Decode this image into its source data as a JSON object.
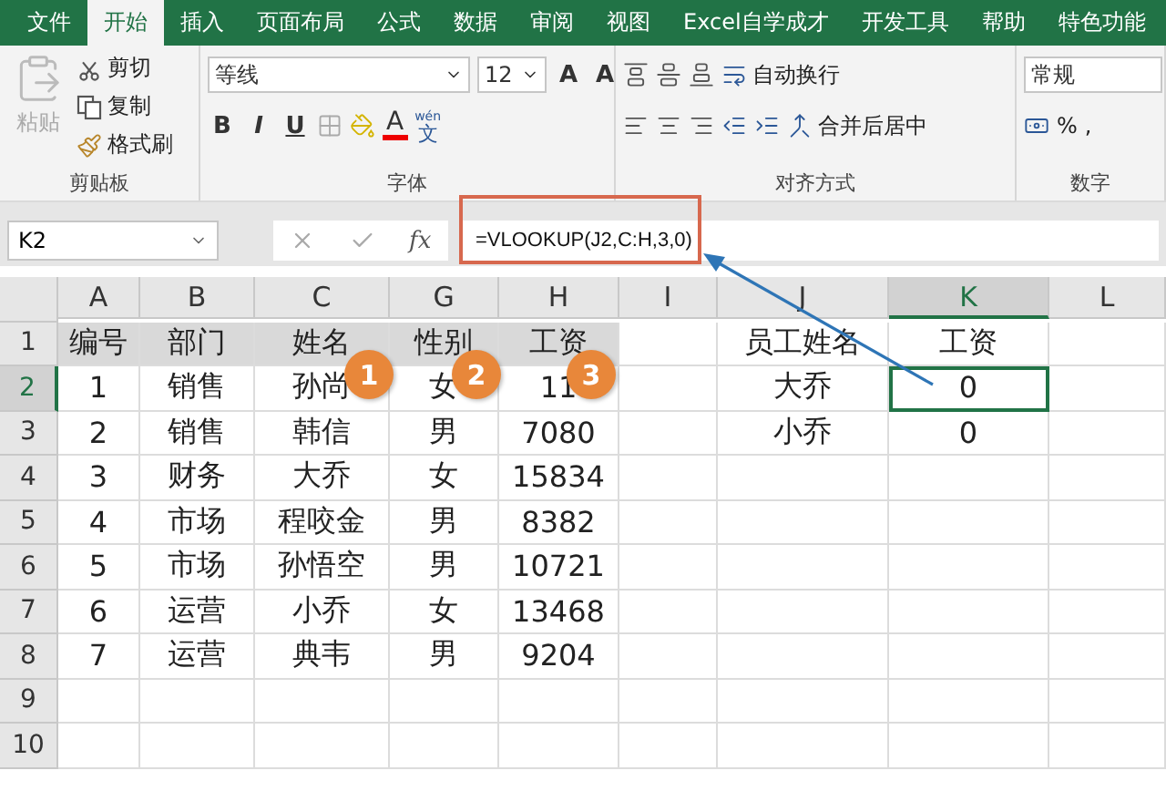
{
  "ribbon_tabs": [
    {
      "label": "文件",
      "selected": false
    },
    {
      "label": "开始",
      "selected": true
    },
    {
      "label": "插入",
      "selected": false
    },
    {
      "label": "页面布局",
      "selected": false
    },
    {
      "label": "公式",
      "selected": false
    },
    {
      "label": "数据",
      "selected": false
    },
    {
      "label": "审阅",
      "selected": false
    },
    {
      "label": "视图",
      "selected": false
    },
    {
      "label": "Excel自学成才",
      "selected": false
    },
    {
      "label": "开发工具",
      "selected": false
    },
    {
      "label": "帮助",
      "selected": false
    },
    {
      "label": "特色功能",
      "selected": false
    }
  ],
  "clipboard": {
    "paste": "粘贴",
    "cut": "剪切",
    "copy": "复制",
    "format_painter": "格式刷",
    "group_label": "剪贴板"
  },
  "font": {
    "name": "等线",
    "size": "12",
    "grow": "A",
    "shrink": "A",
    "bold": "B",
    "italic": "I",
    "underline": "U",
    "color_letter": "A",
    "phonetic_top": "wén",
    "phonetic_main": "文",
    "group_label": "字体"
  },
  "alignment": {
    "wrap": "自动换行",
    "merge": "合并后居中",
    "group_label": "对齐方式"
  },
  "number": {
    "format": "常规",
    "percent": "%",
    "comma": ",",
    "group_label": "数字"
  },
  "formula_bar": {
    "name_box": "K2",
    "fx": "fx",
    "formula": "=VLOOKUP(J2,C:H,3,0)"
  },
  "columns": [
    {
      "label": "A",
      "selected": false
    },
    {
      "label": "B",
      "selected": false
    },
    {
      "label": "C",
      "selected": false
    },
    {
      "label": "G",
      "selected": false
    },
    {
      "label": "H",
      "selected": false
    },
    {
      "label": "I",
      "selected": false
    },
    {
      "label": "J",
      "selected": false
    },
    {
      "label": "K",
      "selected": true
    },
    {
      "label": "L",
      "selected": false
    }
  ],
  "rows": [
    {
      "number": "1",
      "selected": false,
      "shaded": true,
      "cells": [
        "编号",
        "部门",
        "姓名",
        "性别",
        "工资",
        "",
        "员工姓名",
        "工资",
        ""
      ]
    },
    {
      "number": "2",
      "selected": true,
      "shaded": false,
      "cells": [
        "1",
        "销售",
        "孙尚",
        "女",
        "11",
        "",
        "大乔",
        "0",
        ""
      ]
    },
    {
      "number": "3",
      "selected": false,
      "shaded": false,
      "cells": [
        "2",
        "销售",
        "韩信",
        "男",
        "7080",
        "",
        "小乔",
        "0",
        ""
      ]
    },
    {
      "number": "4",
      "selected": false,
      "shaded": false,
      "cells": [
        "3",
        "财务",
        "大乔",
        "女",
        "15834",
        "",
        "",
        "",
        ""
      ]
    },
    {
      "number": "5",
      "selected": false,
      "shaded": false,
      "cells": [
        "4",
        "市场",
        "程咬金",
        "男",
        "8382",
        "",
        "",
        "",
        ""
      ]
    },
    {
      "number": "6",
      "selected": false,
      "shaded": false,
      "cells": [
        "5",
        "市场",
        "孙悟空",
        "男",
        "10721",
        "",
        "",
        "",
        ""
      ]
    },
    {
      "number": "7",
      "selected": false,
      "shaded": false,
      "cells": [
        "6",
        "运营",
        "小乔",
        "女",
        "13468",
        "",
        "",
        "",
        ""
      ]
    },
    {
      "number": "8",
      "selected": false,
      "shaded": false,
      "cells": [
        "7",
        "运营",
        "典韦",
        "男",
        "9204",
        "",
        "",
        "",
        ""
      ]
    },
    {
      "number": "9",
      "selected": false,
      "shaded": false,
      "cells": [
        "",
        "",
        "",
        "",
        "",
        "",
        "",
        "",
        ""
      ]
    },
    {
      "number": "10",
      "selected": false,
      "shaded": false,
      "cells": [
        "",
        "",
        "",
        "",
        "",
        "",
        "",
        "",
        ""
      ]
    }
  ],
  "badges": [
    "1",
    "2",
    "3"
  ]
}
